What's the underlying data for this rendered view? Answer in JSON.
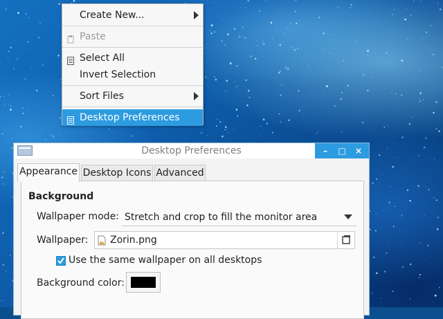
{
  "context_menu": {
    "items": [
      {
        "label": "Create New...",
        "submenu": true
      },
      {
        "label": "Paste",
        "disabled": true,
        "icon": "paste-icon"
      },
      {
        "label": "Select All",
        "icon": "select-all-icon"
      },
      {
        "label": "Invert Selection"
      },
      {
        "label": "Sort Files",
        "submenu": true
      },
      {
        "label": "Desktop Preferences",
        "active": true,
        "icon": "preferences-icon"
      }
    ]
  },
  "dialog": {
    "title": "Desktop Preferences",
    "window_buttons": {
      "minimize": "–",
      "maximize": "□",
      "close": "×"
    },
    "tabs": [
      {
        "label": "Appearance",
        "active": true
      },
      {
        "label": "Desktop Icons"
      },
      {
        "label": "Advanced"
      }
    ],
    "section_title": "Background",
    "wallpaper_mode": {
      "label": "Wallpaper mode:",
      "value": "Stretch and crop to fill the monitor area"
    },
    "wallpaper": {
      "label": "Wallpaper:",
      "value": "Zorin.png"
    },
    "same_wallpaper": {
      "label": "Use the same wallpaper on all desktops",
      "checked": true
    },
    "background_color": {
      "label": "Background color:",
      "value": "#000000"
    }
  },
  "colors": {
    "accent": "#2d9be0",
    "menu_bg": "#f7f7f7",
    "dialog_bg": "#f3f3f3"
  }
}
